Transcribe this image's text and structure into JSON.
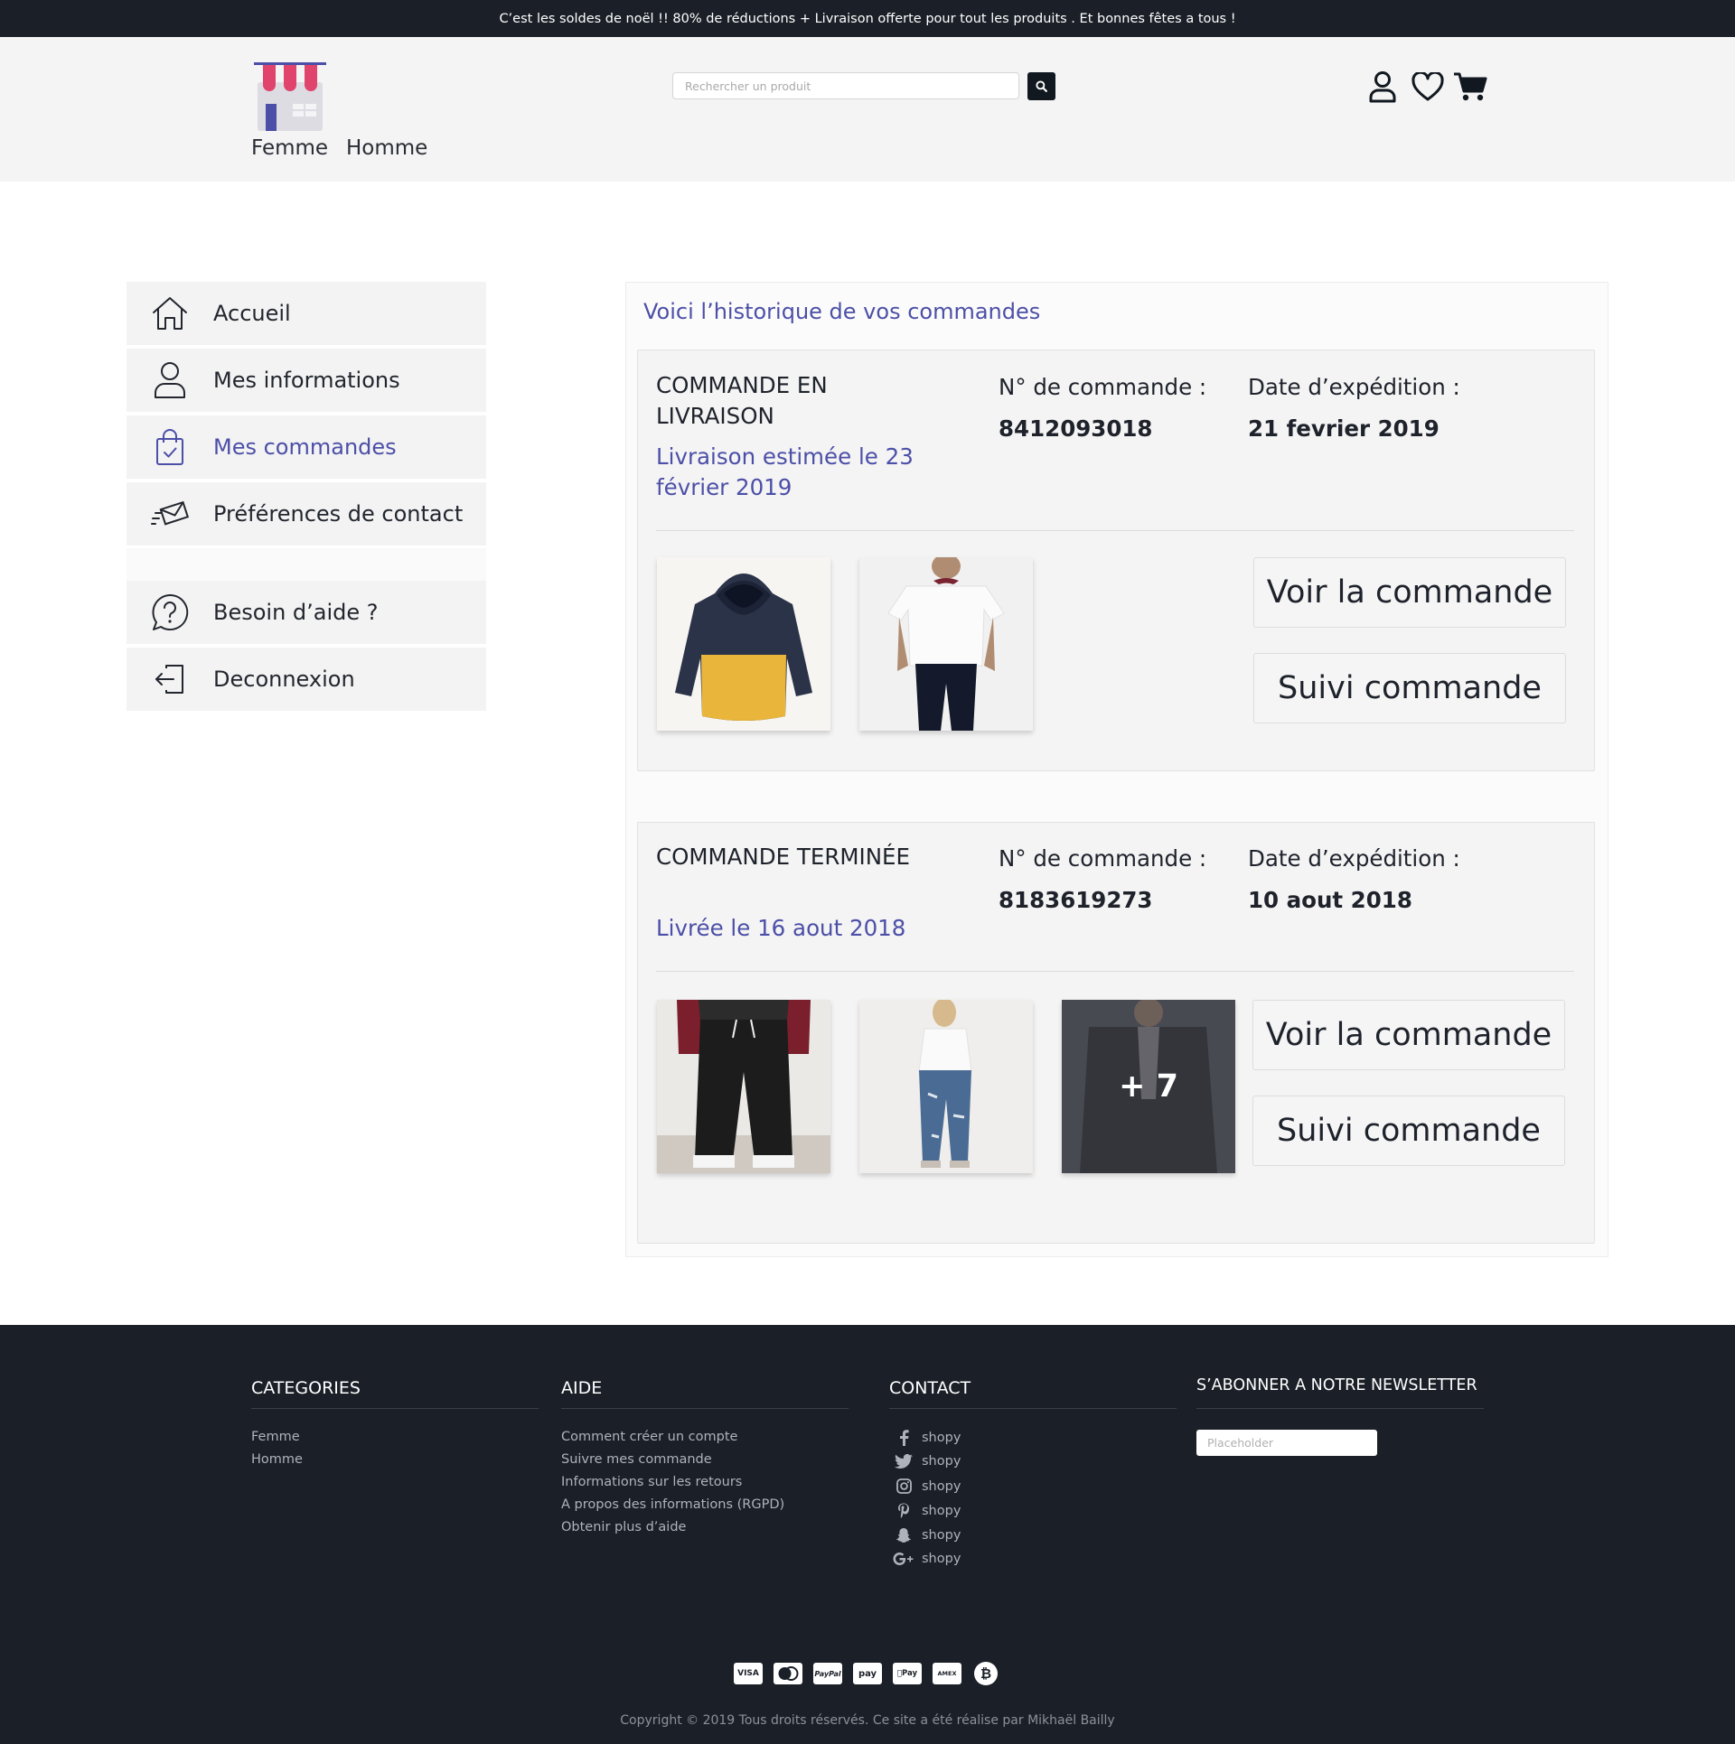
{
  "banner": {
    "text": "C’est les soldes de noël !! 80% de réductions + Livraison offerte pour tout les produits . Et bonnes fêtes a tous !"
  },
  "header": {
    "nav": {
      "femme": "Femme",
      "homme": "Homme"
    },
    "search": {
      "placeholder": "Rechercher un produit",
      "icon": "search-icon"
    },
    "icons": [
      "user-icon",
      "heart-icon",
      "cart-icon"
    ],
    "colors": {
      "logo_awning": "#e0436b",
      "logo_accent": "#4c4fa7"
    }
  },
  "sidebar": {
    "items": [
      {
        "label": "Accueil",
        "icon": "home-icon"
      },
      {
        "label": "Mes informations",
        "icon": "user-icon"
      },
      {
        "label": "Mes commandes",
        "icon": "shopping-bag-icon",
        "active": true
      },
      {
        "label": "Préférences de contact",
        "icon": "envelope-icon"
      },
      {
        "label": "Besoin d’aide ?",
        "icon": "help-bubble-icon"
      },
      {
        "label": "Deconnexion",
        "icon": "logout-icon"
      }
    ]
  },
  "main": {
    "title": "Voici l’historique de vos commandes",
    "accent_color": "#4c4fa7",
    "orders": [
      {
        "status": "COMMANDE EN LIVRAISON",
        "sub": "Livraison estimée le 23 février 2019",
        "number_label": "N° de commande :",
        "number": "8412093018",
        "date_label": "Date d’expédition :",
        "date": "21 fevrier 2019",
        "view_label": "Voir la commande",
        "track_label": "Suivi commande"
      },
      {
        "status": "COMMANDE TERMINÉE",
        "sub": "Livrée le 16 aout 2018",
        "number_label": "N° de commande :",
        "number": "8183619273",
        "date_label": "Date d’expédition :",
        "date": "10 aout 2018",
        "more_count": "+ 7",
        "view_label": "Voir la commande",
        "track_label": "Suivi commande"
      }
    ]
  },
  "footer": {
    "categories": {
      "title": "CATEGORIES",
      "links": [
        "Femme",
        "Homme"
      ]
    },
    "aide": {
      "title": "AIDE",
      "links": [
        "Comment créer un compte",
        "Suivre mes commande",
        "Informations sur les retours",
        "A propos des informations (RGPD)",
        "Obtenir plus d’aide"
      ]
    },
    "contact": {
      "title": "CONTACT",
      "items": [
        {
          "icon": "facebook-icon",
          "label": "shopy"
        },
        {
          "icon": "twitter-icon",
          "label": "shopy"
        },
        {
          "icon": "instagram-icon",
          "label": "shopy"
        },
        {
          "icon": "pinterest-icon",
          "label": "shopy"
        },
        {
          "icon": "snapchat-icon",
          "label": "shopy"
        },
        {
          "icon": "google-plus-icon",
          "label": "shopy"
        }
      ]
    },
    "newsletter": {
      "title": "S’ABONNER A NOTRE NEWSLETTER",
      "placeholder": "Placeholder"
    },
    "payments": [
      "visa-icon",
      "mastercard-icon",
      "paypal-icon",
      "amazon-pay-icon",
      "apple-pay-icon",
      "amex-icon",
      "bitcoin-icon"
    ],
    "copyright": "Copyright © 2019 Tous droits réservés. Ce site a été réalise par Mikhaël Bailly"
  }
}
